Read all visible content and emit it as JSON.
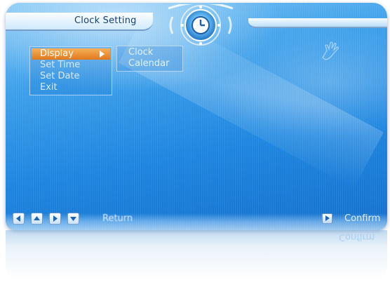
{
  "header": {
    "title": "Clock Setting"
  },
  "main_menu": {
    "items": [
      {
        "label": "Display",
        "selected": true,
        "has_submenu": true
      },
      {
        "label": "Set Time",
        "selected": false
      },
      {
        "label": "Set Date",
        "selected": false
      },
      {
        "label": "Exit",
        "selected": false
      }
    ]
  },
  "sub_menu": {
    "items": [
      {
        "label": "Clock"
      },
      {
        "label": "Calendar"
      }
    ]
  },
  "footer": {
    "return_label": "Return",
    "confirm_label": "Confirm"
  },
  "icons": {
    "emblem": "clock-icon",
    "submenu_arrow": "arrow-right-icon",
    "decor": "hand-icon",
    "nav_left": "arrow-left-icon",
    "nav_up": "arrow-up-icon",
    "nav_right": "arrow-right-icon",
    "nav_down": "arrow-down-icon",
    "confirm": "play-icon"
  },
  "colors": {
    "selection": "#e8892a",
    "screen": "#1d86e0",
    "text": "#d4ebff"
  }
}
